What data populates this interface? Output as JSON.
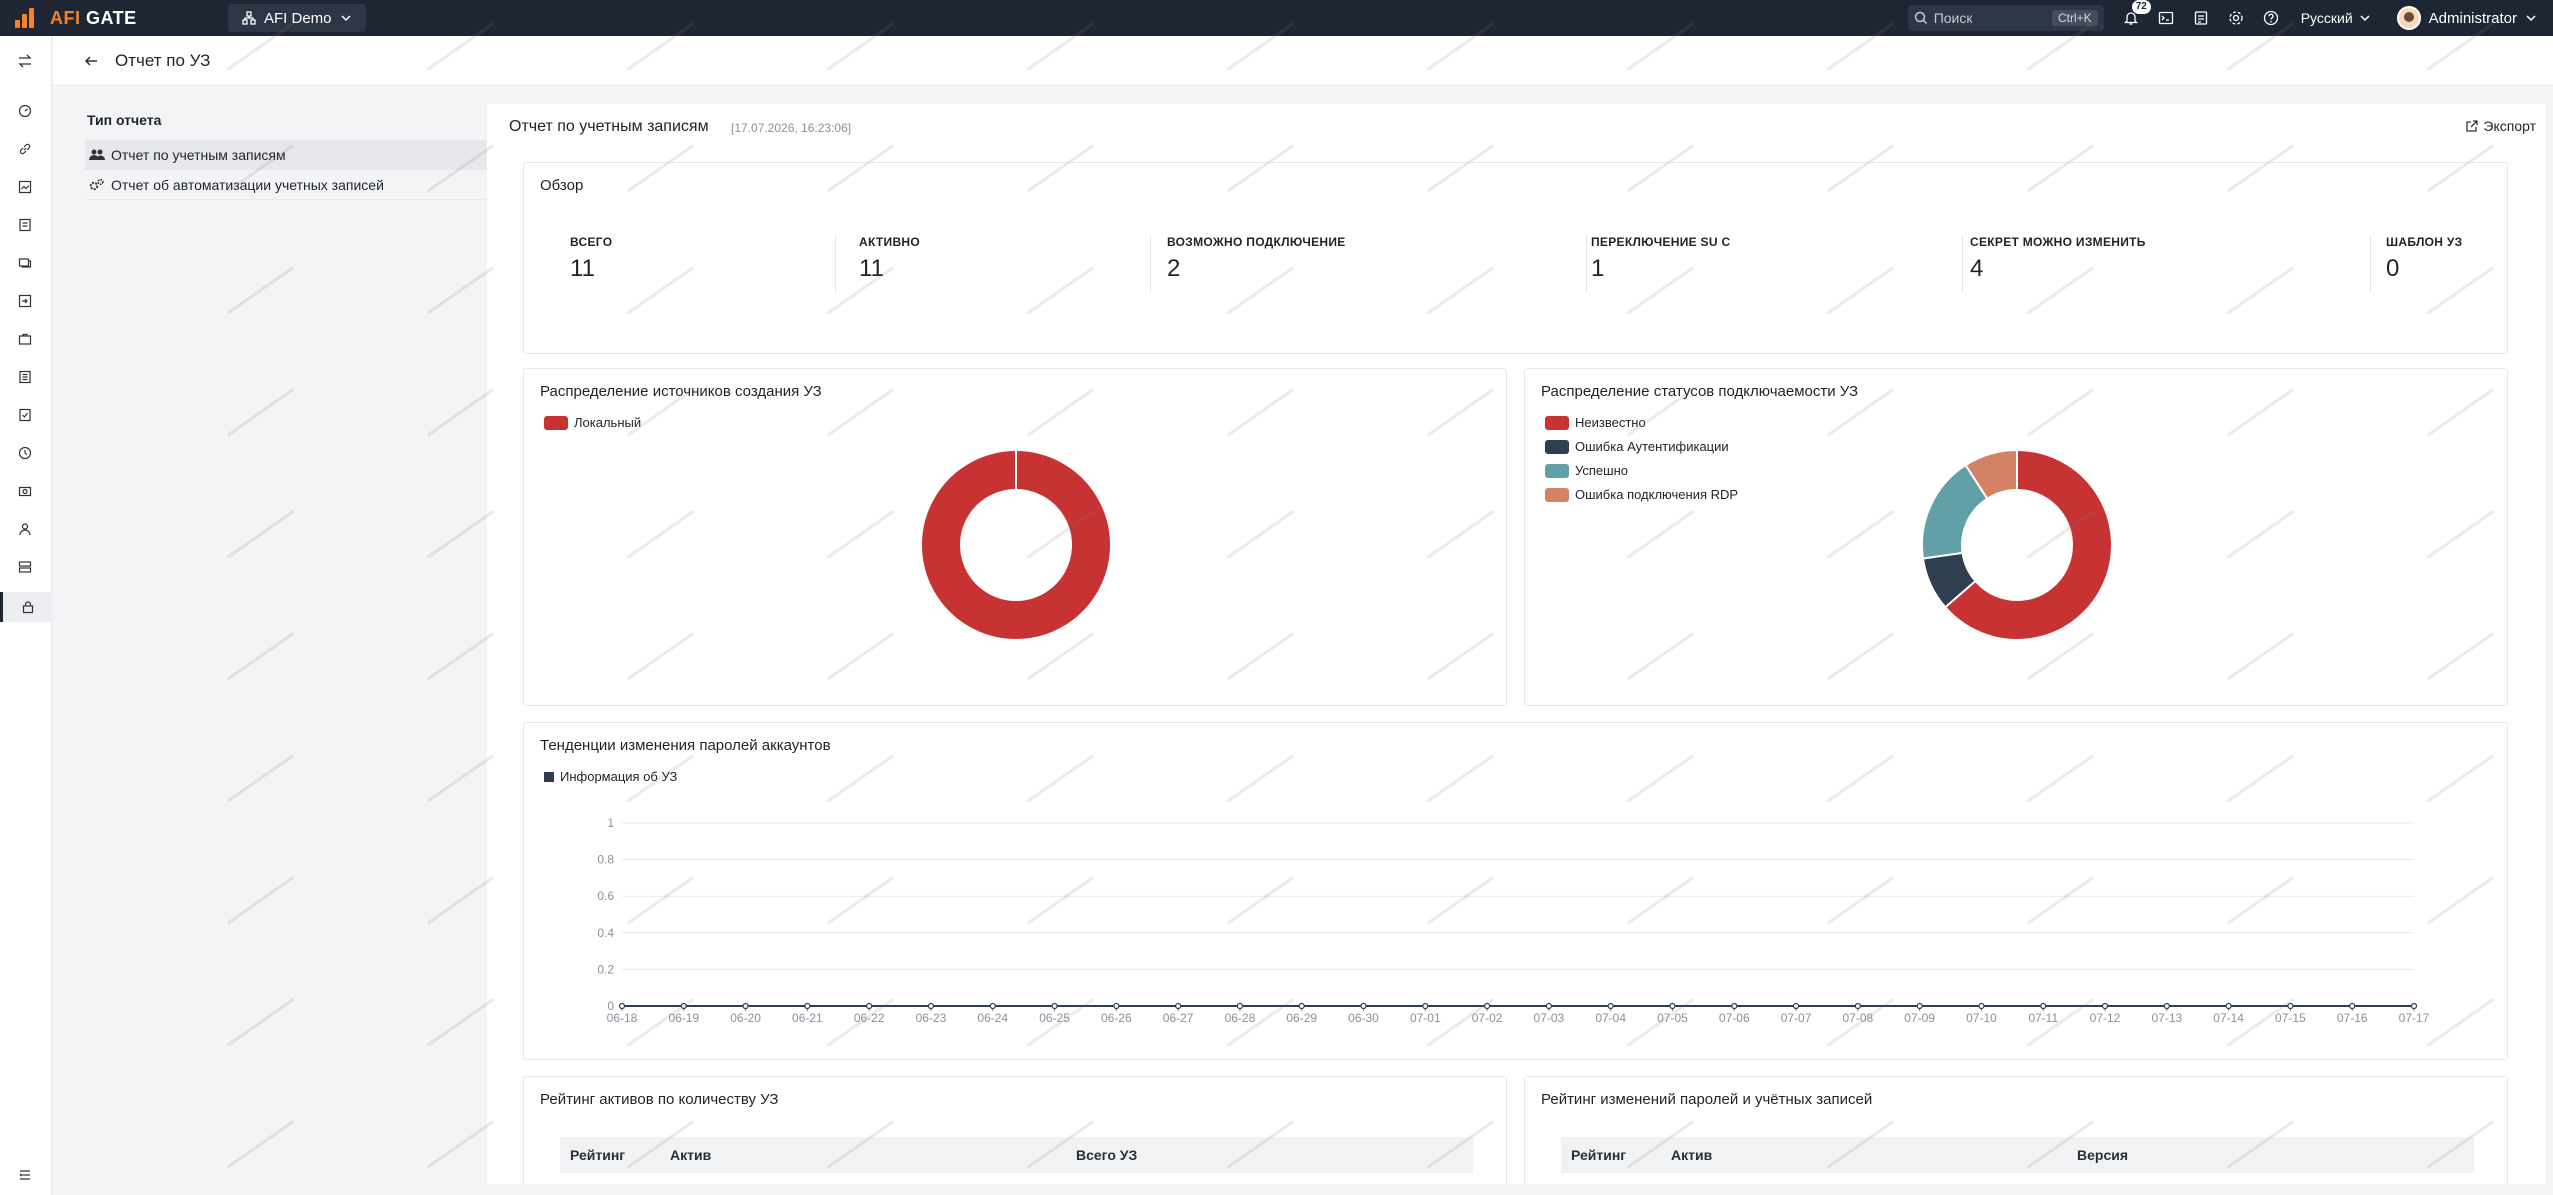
{
  "app": {
    "brand_left": "AFI",
    "brand_right": "GATE",
    "org": "AFI Demo",
    "search_placeholder": "Поиск",
    "search_shortcut": "Ctrl+K",
    "notifications_count": "72",
    "language": "Русский",
    "user": "Administrator"
  },
  "page": {
    "title": "Отчет по УЗ"
  },
  "report_type": {
    "heading": "Тип отчета",
    "items": [
      {
        "label": "Отчет по учетным записям",
        "selected": true
      },
      {
        "label": "Отчет об автоматизации учетных записей",
        "selected": false
      }
    ]
  },
  "report": {
    "title": "Отчет по учетным записям",
    "timestamp": "[17.07.2026, 16:23:06]",
    "export_label": "Экспорт"
  },
  "overview": {
    "title": "Обзор",
    "stats": [
      {
        "label": "ВСЕГО",
        "value": "11"
      },
      {
        "label": "АКТИВНО",
        "value": "11"
      },
      {
        "label": "ВОЗМОЖНО ПОДКЛЮЧЕНИЕ",
        "value": "2"
      },
      {
        "label": "ПЕРЕКЛЮЧЕНИЕ SU С",
        "value": "1"
      },
      {
        "label": "СЕКРЕТ МОЖНО ИЗМЕНИТЬ",
        "value": "4"
      },
      {
        "label": "ШАБЛОН УЗ",
        "value": "0"
      }
    ]
  },
  "colors": {
    "red": "#c73332",
    "navy": "#2f3f4f",
    "teal": "#61a0a8",
    "orange": "#d48265"
  },
  "chart_data": [
    {
      "type": "pie",
      "title": "Распределение источников создания УЗ",
      "series": [
        {
          "name": "Локальный",
          "value": 11,
          "color": "#c73332"
        }
      ]
    },
    {
      "type": "pie",
      "title": "Распределение статусов подключаемости УЗ",
      "series": [
        {
          "name": "Неизвестно",
          "value": 7,
          "color": "#c73332"
        },
        {
          "name": "Ошибка Аутентификации",
          "value": 1,
          "color": "#2f3f4f"
        },
        {
          "name": "Успешно",
          "value": 2,
          "color": "#61a0a8"
        },
        {
          "name": "Ошибка подключения RDP",
          "value": 1,
          "color": "#d48265"
        }
      ]
    },
    {
      "type": "line",
      "title": "Тенденции изменения паролей аккаунтов",
      "series": [
        {
          "name": "Информация об УЗ",
          "color": "#2f3f4f",
          "values": [
            0,
            0,
            0,
            0,
            0,
            0,
            0,
            0,
            0,
            0,
            0,
            0,
            0,
            0,
            0,
            0,
            0,
            0,
            0,
            0,
            0,
            0,
            0,
            0,
            0,
            0,
            0,
            0,
            0,
            0
          ]
        }
      ],
      "x": [
        "06-18",
        "06-19",
        "06-20",
        "06-21",
        "06-22",
        "06-23",
        "06-24",
        "06-25",
        "06-26",
        "06-27",
        "06-28",
        "06-29",
        "06-30",
        "07-01",
        "07-02",
        "07-03",
        "07-04",
        "07-05",
        "07-06",
        "07-07",
        "07-08",
        "07-09",
        "07-10",
        "07-11",
        "07-12",
        "07-13",
        "07-14",
        "07-15",
        "07-16",
        "07-17"
      ],
      "y_ticks": [
        "0",
        "0.2",
        "0.4",
        "0.6",
        "0.8",
        "1"
      ],
      "ylim": [
        0,
        1
      ],
      "grid": true
    }
  ],
  "ranking_assets": {
    "title": "Рейтинг активов по количеству УЗ",
    "columns": [
      "Рейтинг",
      "Актив",
      "Всего УЗ"
    ]
  },
  "ranking_changes": {
    "title": "Рейтинг изменений паролей и учётных записей",
    "columns": [
      "Рейтинг",
      "Актив",
      "Версия"
    ]
  }
}
